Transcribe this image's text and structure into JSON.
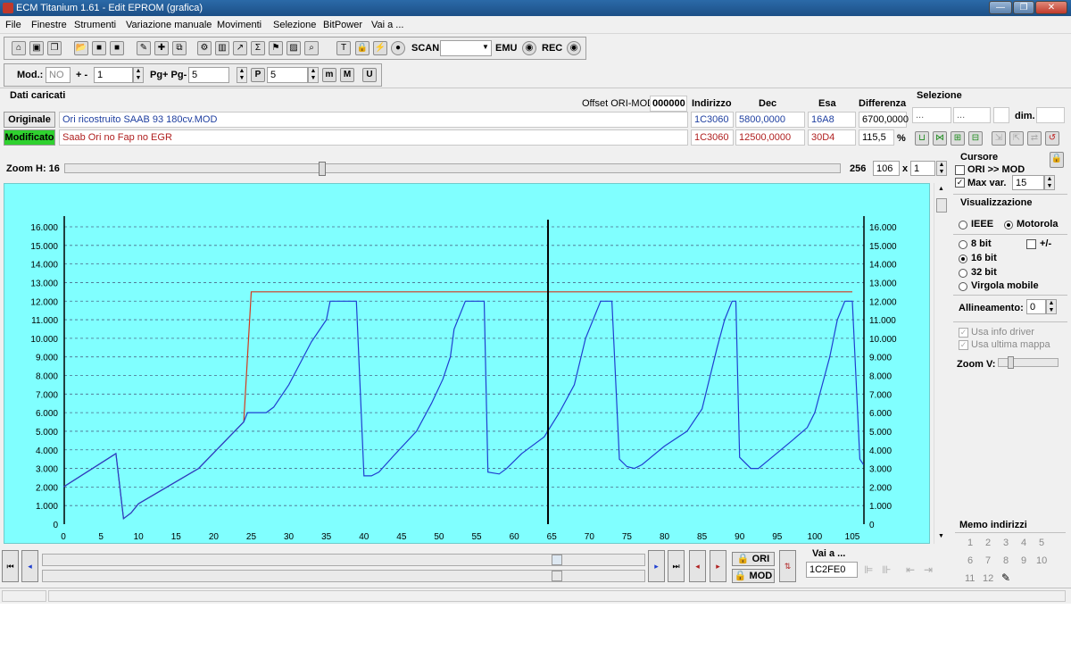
{
  "window": {
    "title": "ECM Titanium 1.61 - Edit EPROM (grafica)",
    "controls": [
      "—",
      "❐",
      "✕"
    ]
  },
  "menu": [
    "File",
    "Finestre",
    "Strumenti",
    "Variazione manuale",
    "Movimenti",
    "Selezione",
    "BitPower",
    "Vai a ..."
  ],
  "toolbar1": {
    "scan": "SCAN",
    "emu": "EMU",
    "rec": "REC",
    "scan_value": ""
  },
  "toolbar2": {
    "mod_label": "Mod.:",
    "mod_value": "NO",
    "plusminus_label": "+ -",
    "plusminus_value": "1",
    "pg_label": "Pg+ Pg-",
    "pg_value": "5",
    "p_icon": "P",
    "p_value": "5",
    "m_icon": "m",
    "m2_icon": "M",
    "u_icon": "U"
  },
  "data": {
    "title": "Dati caricati",
    "offset_label": "Offset ORI-MOD",
    "offset_value": "000000",
    "headers": {
      "indirizzo": "Indirizzo",
      "dec": "Dec",
      "esa": "Esa",
      "differenza": "Differenza"
    },
    "original": {
      "tag": "Originale",
      "file": "Ori ricostruito SAAB 93 180cv.MOD",
      "indirizzo": "1C3060",
      "dec": "5800,0000",
      "esa": "16A8",
      "diff": "6700,0000"
    },
    "modified": {
      "tag": "Modificato",
      "file": "Saab Ori no Fap no EGR",
      "indirizzo": "1C3060",
      "dec": "12500,0000",
      "esa": "30D4",
      "diff": "115,5",
      "pct": "%"
    }
  },
  "selezione": {
    "title": "Selezione",
    "a": "...",
    "b": "...",
    "c": "",
    "dim_label": "dim.",
    "dim_value": ""
  },
  "zoom": {
    "label": "Zoom H: 16",
    "max": "256",
    "value": "106",
    "x": "x",
    "factor": "1",
    "fraction": 0.33
  },
  "cursore": {
    "title": "Cursore",
    "ori_mod": "ORI >> MOD",
    "max_var": "Max var.",
    "max_var_value": "15"
  },
  "visualizzazione": {
    "title": "Visualizzazione",
    "ieee": "IEEE",
    "motorola": "Motorola",
    "b8": "8 bit",
    "plusminus": "+/-",
    "b16": "16 bit",
    "b32": "32 bit",
    "float": "Virgola mobile",
    "allineamento": "Allineamento:",
    "allineamento_value": "0",
    "usa_info": "Usa info driver",
    "usa_ultima": "Usa ultima mappa",
    "zoomv": "Zoom V:"
  },
  "memo": {
    "title": "Memo indirizzi",
    "items": [
      "1",
      "2",
      "3",
      "4",
      "5",
      "6",
      "7",
      "8",
      "9",
      "10",
      "11",
      "12"
    ]
  },
  "bottom": {
    "ori_btn": "ORI",
    "mod_btn": "MOD",
    "vai_label": "Vai a ...",
    "vai_value": "1C2FE0"
  },
  "colors": {
    "chart_bg": "#80ffff",
    "original_line": "#1f3fd0",
    "modified_line": "#d23a1e",
    "modified_tag_bg": "#2fd12f"
  },
  "chart_data": {
    "type": "line",
    "x_ticks": [
      "0",
      "5",
      "10",
      "15",
      "20",
      "25",
      "30",
      "35",
      "40",
      "45",
      "50",
      "55",
      "60",
      "65",
      "70",
      "75",
      "80",
      "85",
      "90",
      "95",
      "100",
      "105"
    ],
    "y_ticks": [
      "0",
      "1.000",
      "2.000",
      "3.000",
      "4.000",
      "5.000",
      "6.000",
      "7.000",
      "8.000",
      "9.000",
      "10.000",
      "11.000",
      "12.000",
      "13.000",
      "14.000",
      "15.000",
      "16.000"
    ],
    "xlim": [
      0,
      105
    ],
    "ylim": [
      0,
      16000
    ],
    "cursor_x": 64.5,
    "grid": true,
    "series": [
      {
        "color": "#1f3fd0",
        "points": [
          [
            0,
            2000
          ],
          [
            7,
            3800
          ],
          [
            8,
            300
          ],
          [
            9,
            600
          ],
          [
            10,
            1100
          ],
          [
            18,
            3000
          ],
          [
            24,
            5500
          ],
          [
            24.5,
            6000
          ],
          [
            27,
            6000
          ],
          [
            28,
            6300
          ],
          [
            30,
            7500
          ],
          [
            33,
            9800
          ],
          [
            35,
            11000
          ],
          [
            35.5,
            12000
          ],
          [
            37,
            12000
          ],
          [
            39,
            12000
          ],
          [
            40,
            2600
          ],
          [
            41,
            2600
          ],
          [
            42,
            2800
          ],
          [
            44,
            3700
          ],
          [
            47,
            5000
          ],
          [
            49,
            6500
          ],
          [
            50.5,
            7800
          ],
          [
            51.5,
            9000
          ],
          [
            52,
            10500
          ],
          [
            53.5,
            12000
          ],
          [
            55,
            12000
          ],
          [
            56,
            12000
          ],
          [
            56.5,
            2800
          ],
          [
            58,
            2700
          ],
          [
            59,
            3000
          ],
          [
            61,
            3800
          ],
          [
            64,
            4700
          ],
          [
            66,
            6000
          ],
          [
            68,
            7500
          ],
          [
            69.5,
            10000
          ],
          [
            70.5,
            11000
          ],
          [
            71.5,
            12000
          ],
          [
            73,
            12000
          ],
          [
            74,
            3500
          ],
          [
            75,
            3100
          ],
          [
            76,
            3000
          ],
          [
            77,
            3200
          ],
          [
            80,
            4200
          ],
          [
            83,
            5000
          ],
          [
            85,
            6200
          ],
          [
            87,
            9500
          ],
          [
            88,
            11000
          ],
          [
            89,
            12000
          ],
          [
            89.5,
            12000
          ],
          [
            90,
            3600
          ],
          [
            91.5,
            3000
          ],
          [
            92.5,
            3000
          ],
          [
            94,
            3500
          ],
          [
            97,
            4500
          ],
          [
            99,
            5200
          ],
          [
            100,
            6000
          ],
          [
            101,
            7500
          ],
          [
            102,
            9000
          ],
          [
            103,
            11000
          ],
          [
            104,
            12000
          ],
          [
            105,
            12000
          ],
          [
            106,
            3500
          ],
          [
            106.5,
            3200
          ]
        ]
      },
      {
        "color": "#d23a1e",
        "points": [
          [
            0,
            2000
          ],
          [
            7,
            3800
          ],
          [
            8,
            300
          ],
          [
            9,
            600
          ],
          [
            10,
            1100
          ],
          [
            18,
            3000
          ],
          [
            24,
            5500
          ],
          [
            25,
            12500
          ],
          [
            105,
            12500
          ]
        ]
      }
    ]
  }
}
